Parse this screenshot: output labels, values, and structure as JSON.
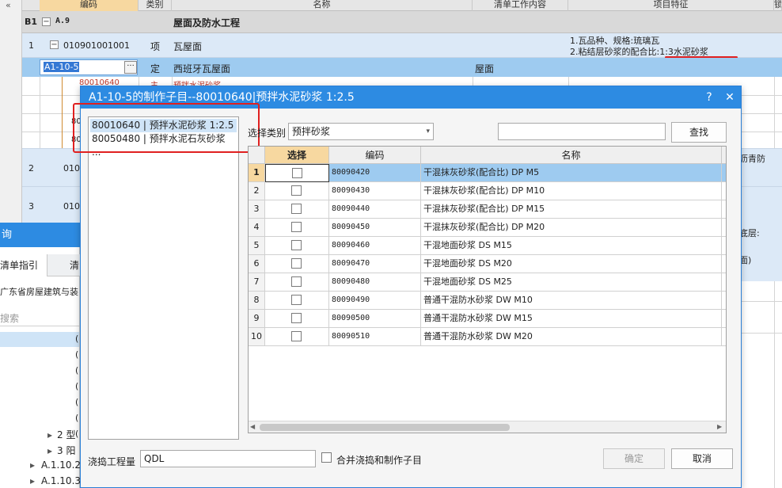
{
  "grid": {
    "collapse_icon": "double-chevron-left-icon",
    "header": {
      "code": "编码",
      "type": "类别",
      "name": "名称",
      "content": "清单工作内容",
      "feature": "项目特征",
      "extra": "锁"
    },
    "section_row": {
      "label": "B1",
      "toggle": "−",
      "code": "A.9",
      "name": "屋面及防水工程"
    },
    "row1": {
      "num": "1",
      "toggle": "−",
      "code": "010901001001",
      "type": "项",
      "name": "瓦屋面",
      "feature_line1": "1.瓦品种、规格:琉璃瓦",
      "feature_line2": "2.粘结层砂浆的配合比:1:3水泥砂浆"
    },
    "row_edit": {
      "code": "A1-10-5",
      "ellipsis": "···",
      "type": "定",
      "name": "西班牙瓦屋面",
      "content": "屋面"
    },
    "sub_partial": {
      "code": "80010640",
      "type": "主",
      "name": "预拌水泥砂浆"
    },
    "hidden_codes": [
      "80",
      "80"
    ],
    "row2": {
      "num": "2",
      "code": "0109",
      "feature": "沥青防"
    },
    "row3": {
      "num": "3",
      "code": "0109",
      "feature_a": "底层:",
      "feature_b": "面)"
    }
  },
  "left_panel": {
    "title": "询",
    "tabs": [
      "清单指引",
      "清"
    ],
    "library": "广东省房屋建筑与装",
    "search_placeholder": "搜索",
    "tree_items": [
      "(",
      "(",
      "(",
      "(",
      "(",
      "(",
      "("
    ],
    "nodes": [
      {
        "arrow": "▸",
        "label": "2 型"
      },
      {
        "arrow": "▸",
        "label": "3 阳"
      },
      {
        "arrow": "▸",
        "label": "A.1.10.2"
      },
      {
        "arrow": "▸",
        "label": "A.1.10.3"
      }
    ]
  },
  "dialog": {
    "title": "A1-10-5的制作子目--80010640|预拌水泥砂浆 1:2.5",
    "help": "?",
    "close": "✕",
    "sub_items": [
      "80010640 | 预拌水泥砂浆 1:2.5",
      "80050480 | 预拌水泥石灰砂浆 ..."
    ],
    "category_label": "选择类别",
    "category_value": "预拌砂浆",
    "search_value": "",
    "search_button": "查找",
    "columns": {
      "select": "选择",
      "code": "编码",
      "name": "名称"
    },
    "rows": [
      {
        "num": "1",
        "code": "80090420",
        "name": "干混抹灰砂浆(配合比) DP M5"
      },
      {
        "num": "2",
        "code": "80090430",
        "name": "干混抹灰砂浆(配合比) DP M10"
      },
      {
        "num": "3",
        "code": "80090440",
        "name": "干混抹灰砂浆(配合比) DP M15"
      },
      {
        "num": "4",
        "code": "80090450",
        "name": "干混抹灰砂浆(配合比) DP M20"
      },
      {
        "num": "5",
        "code": "80090460",
        "name": "干混地面砂浆 DS M15"
      },
      {
        "num": "6",
        "code": "80090470",
        "name": "干混地面砂浆 DS M20"
      },
      {
        "num": "7",
        "code": "80090480",
        "name": "干混地面砂浆 DS M25"
      },
      {
        "num": "8",
        "code": "80090490",
        "name": "普通干混防水砂浆 DW M10"
      },
      {
        "num": "9",
        "code": "80090500",
        "name": "普通干混防水砂浆 DW M15"
      },
      {
        "num": "10",
        "code": "80090510",
        "name": "普通干混防水砂浆 DW M20"
      }
    ],
    "pour_label": "浇捣工程量",
    "pour_value": "QDL",
    "merge_label": "合并浇捣和制作子目",
    "ok": "确定",
    "cancel": "取消"
  },
  "colors": {
    "accent": "#2d8be2",
    "highlight_row": "#9ecbf0",
    "selected_row": "#cfe4f7",
    "annotation": "#e02020"
  }
}
